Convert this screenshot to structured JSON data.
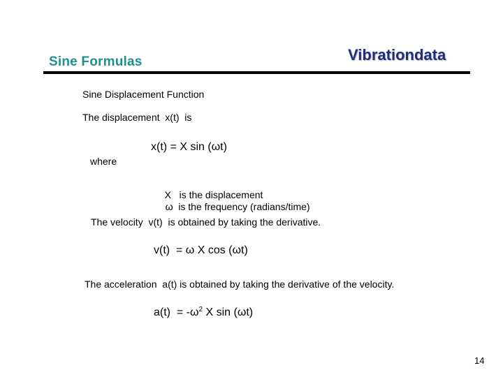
{
  "header": {
    "title": "Sine Formulas",
    "brand": "Vibrationdata"
  },
  "body": {
    "section_heading": "Sine Displacement Function",
    "displacement_intro": "The displacement  x(t)  is",
    "displacement_equation": "x(t) = X sin (ωt)",
    "where_label": "where",
    "definitions": [
      {
        "symbol": "X",
        "text": "is the displacement"
      },
      {
        "symbol": "ω",
        "text": "is the frequency (radians/time)"
      }
    ],
    "velocity_intro": "The velocity  v(t)  is obtained by taking the derivative.",
    "velocity_equation": "v(t)  = ω X cos (ωt)",
    "acceleration_intro": "The acceleration  a(t) is obtained by taking the derivative of the velocity.",
    "acceleration_equation": {
      "prefix": "a(t)  = -ω",
      "exponent": "2",
      "suffix": " X sin (ωt)"
    }
  },
  "footer": {
    "page_number": "14"
  },
  "colors": {
    "title": "#1e918e",
    "brand": "#1c2e7c",
    "rule": "#000000"
  }
}
